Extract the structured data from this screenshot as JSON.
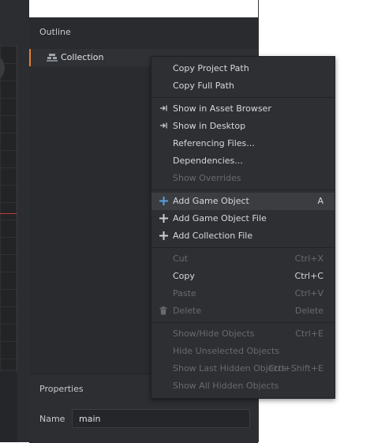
{
  "outline": {
    "header": "Outline",
    "root_label": "Collection",
    "root_icon": "collection-icon"
  },
  "properties": {
    "header": "Properties",
    "name_label": "Name",
    "name_value": "main"
  },
  "colors": {
    "accent": "#e57e32",
    "plus_icon": "#5aa0e0",
    "menu_bg": "#2e2f33",
    "panel_bg": "#2a2b2e"
  },
  "menu": {
    "copy_project_path": "Copy Project Path",
    "copy_full_path": "Copy Full Path",
    "show_in_asset_browser": "Show in Asset Browser",
    "show_in_desktop": "Show in Desktop",
    "referencing_files": "Referencing Files...",
    "dependencies": "Dependencies...",
    "show_overrides": "Show Overrides",
    "add_game_object": "Add Game Object",
    "add_game_object_shortcut": "A",
    "add_game_object_file": "Add Game Object File",
    "add_collection_file": "Add Collection File",
    "cut": "Cut",
    "cut_shortcut": "Ctrl+X",
    "copy": "Copy",
    "copy_shortcut": "Ctrl+C",
    "paste": "Paste",
    "paste_shortcut": "Ctrl+V",
    "delete": "Delete",
    "delete_shortcut": "Delete",
    "show_hide_objects": "Show/Hide Objects",
    "show_hide_objects_shortcut": "Ctrl+E",
    "hide_unselected_objects": "Hide Unselected Objects",
    "show_last_hidden_objects": "Show Last Hidden Objects",
    "show_last_hidden_objects_shortcut": "Ctrl+Shift+E",
    "show_all_hidden_objects": "Show All Hidden Objects"
  }
}
